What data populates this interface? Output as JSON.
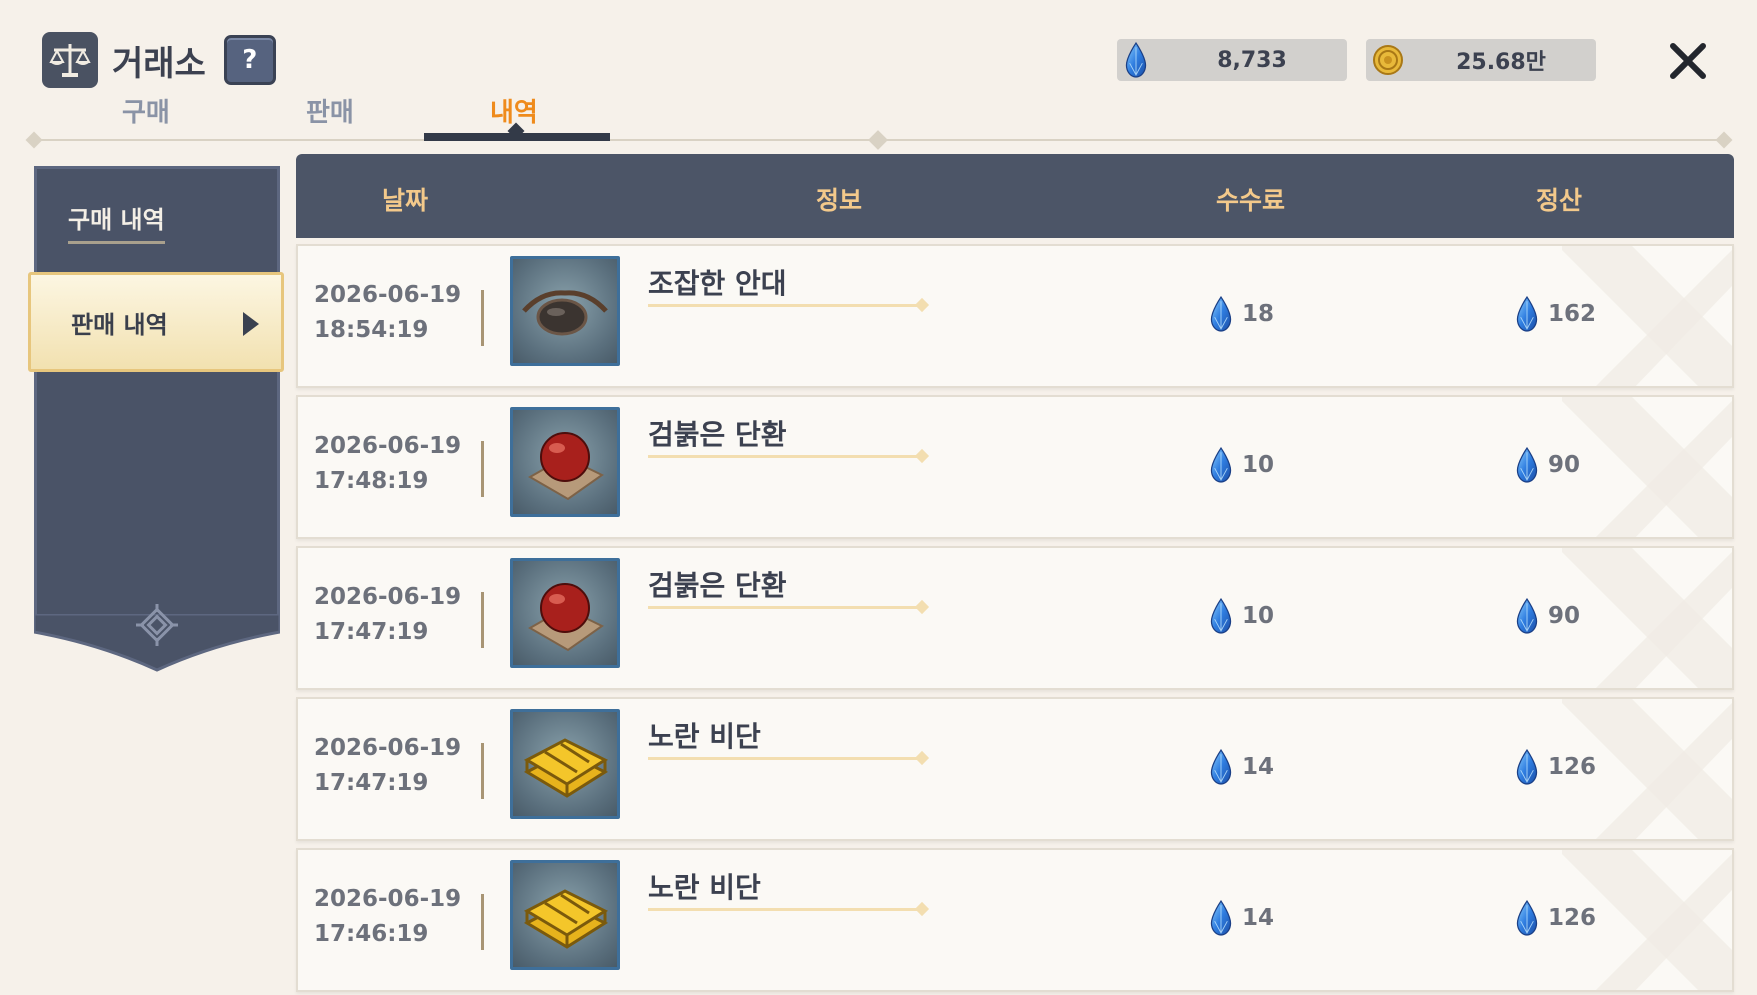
{
  "header": {
    "title": "거래소",
    "help_label": "?",
    "currencies": [
      {
        "icon": "blue-gem-icon",
        "value": "8,733"
      },
      {
        "icon": "gold-coin-icon",
        "value": "25.68만"
      }
    ]
  },
  "tabs": [
    {
      "label": "구매",
      "active": false
    },
    {
      "label": "판매",
      "active": false
    },
    {
      "label": "내역",
      "active": true
    }
  ],
  "sidebar": {
    "items": [
      {
        "label": "구매 내역",
        "active": false
      },
      {
        "label": "판매 내역",
        "active": true
      }
    ]
  },
  "table": {
    "columns": [
      "날짜",
      "정보",
      "수수료",
      "정산"
    ],
    "rows": [
      {
        "date": "2026-06-19",
        "time": "18:54:19",
        "item": "조잡한 안대",
        "icon": "eyepatch-icon",
        "fee": "18",
        "settlement": "162"
      },
      {
        "date": "2026-06-19",
        "time": "17:48:19",
        "item": "검붉은 단환",
        "icon": "red-pill-icon",
        "fee": "10",
        "settlement": "90"
      },
      {
        "date": "2026-06-19",
        "time": "17:47:19",
        "item": "검붉은 단환",
        "icon": "red-pill-icon",
        "fee": "10",
        "settlement": "90"
      },
      {
        "date": "2026-06-19",
        "time": "17:47:19",
        "item": "노란 비단",
        "icon": "yellow-silk-icon",
        "fee": "14",
        "settlement": "126"
      },
      {
        "date": "2026-06-19",
        "time": "17:46:19",
        "item": "노란 비단",
        "icon": "yellow-silk-icon",
        "fee": "14",
        "settlement": "126"
      }
    ]
  },
  "colors": {
    "accent_tab": "#ef8b1c",
    "header_bg": "#4c5567",
    "header_text": "#f3c98b",
    "gem_blue": "#2f7de0"
  }
}
